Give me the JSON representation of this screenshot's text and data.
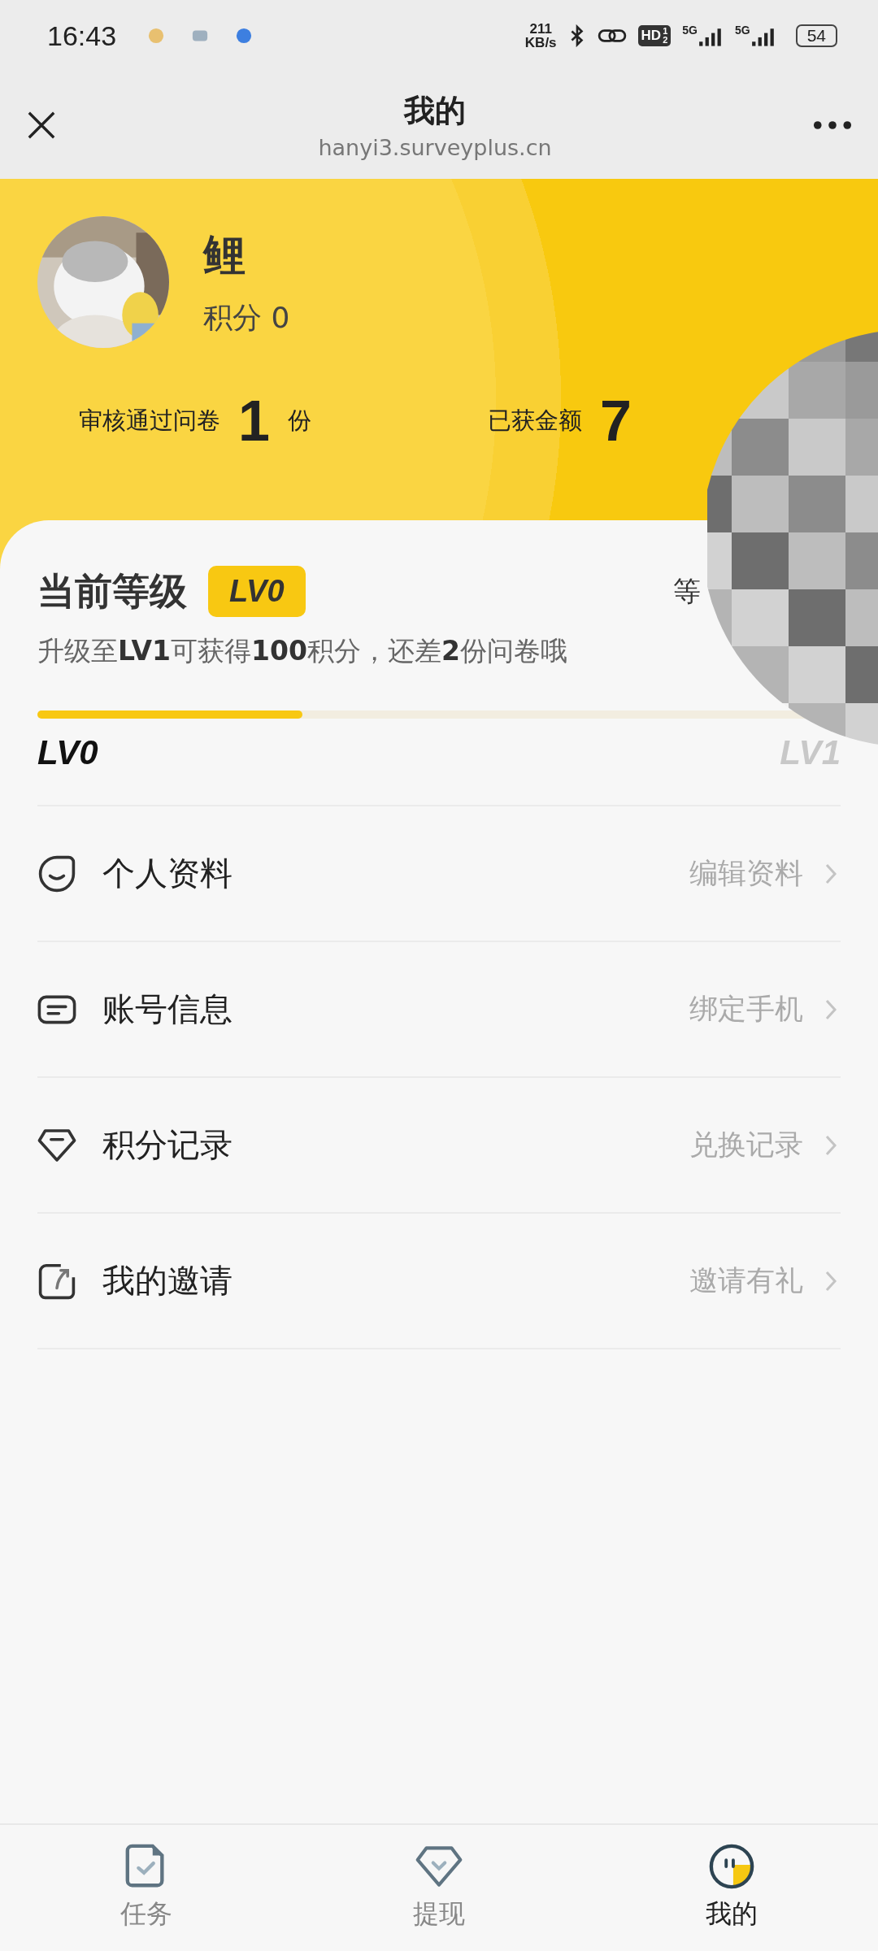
{
  "status_bar": {
    "time": "16:43",
    "net_speed": "211",
    "net_unit": "KB/s",
    "hd": "HD",
    "hd_sims": [
      "1",
      "2"
    ],
    "signals": [
      {
        "label": "5G"
      },
      {
        "label": "5G"
      }
    ],
    "battery": "54"
  },
  "header": {
    "title": "我的",
    "url": "hanyi3.surveyplus.cn"
  },
  "profile": {
    "name": "鲤",
    "points_label": "积分",
    "points": "0"
  },
  "stats": [
    {
      "label": "审核通过问卷",
      "value": "1",
      "unit": "份"
    },
    {
      "label": "已获金额",
      "value": "7"
    }
  ],
  "level": {
    "title": "当前等级",
    "badge": "LV0",
    "link": "等",
    "hint": "升级至**LV1**可获得**100**积分，还差**2**份问卷哦",
    "level": 0.33,
    "from": "LV0",
    "to": "LV1"
  },
  "menu": [
    {
      "kind": "face",
      "label": "个人资料",
      "action": "编辑资料"
    },
    {
      "kind": "card",
      "label": "账号信息",
      "action": "绑定手机"
    },
    {
      "kind": "shield",
      "label": "积分记录",
      "action": "兑换记录"
    },
    {
      "kind": "invite",
      "label": "我的邀请",
      "action": "邀请有礼"
    }
  ],
  "tabs": [
    {
      "kind": "task",
      "label": "任务",
      "selected": false
    },
    {
      "kind": "withdraw",
      "label": "提现",
      "selected": false
    },
    {
      "kind": "me",
      "label": "我的",
      "selected": true
    }
  ]
}
